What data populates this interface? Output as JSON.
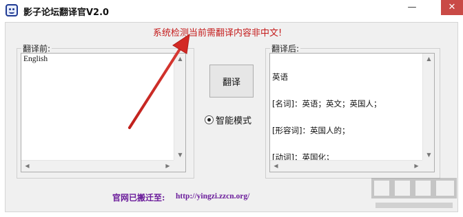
{
  "window": {
    "title": "影子论坛翻译官V2.0",
    "minimize_glyph": "—",
    "close_glyph": "✕"
  },
  "warning": {
    "text": "系统检测当前需翻译内容非中文!",
    "color": "#c41a1a"
  },
  "source": {
    "label": "翻译前:",
    "value": "English"
  },
  "target": {
    "label": "翻译后:",
    "lines": [
      "英语",
      "[名词]：英语；英文；英国人；",
      "[形容词]：英国人的；",
      "[动词]：英国化；"
    ]
  },
  "translate_button": {
    "label": "翻译"
  },
  "mode": {
    "label": "智能模式",
    "selected": true
  },
  "footer": {
    "label": "官网已搬迁至:",
    "url": "http://yingzi.zzcn.org/"
  },
  "icons": {
    "app": "app-face-icon",
    "annotation": "red-arrow-annotation",
    "watermark": "site-watermark-logo"
  }
}
